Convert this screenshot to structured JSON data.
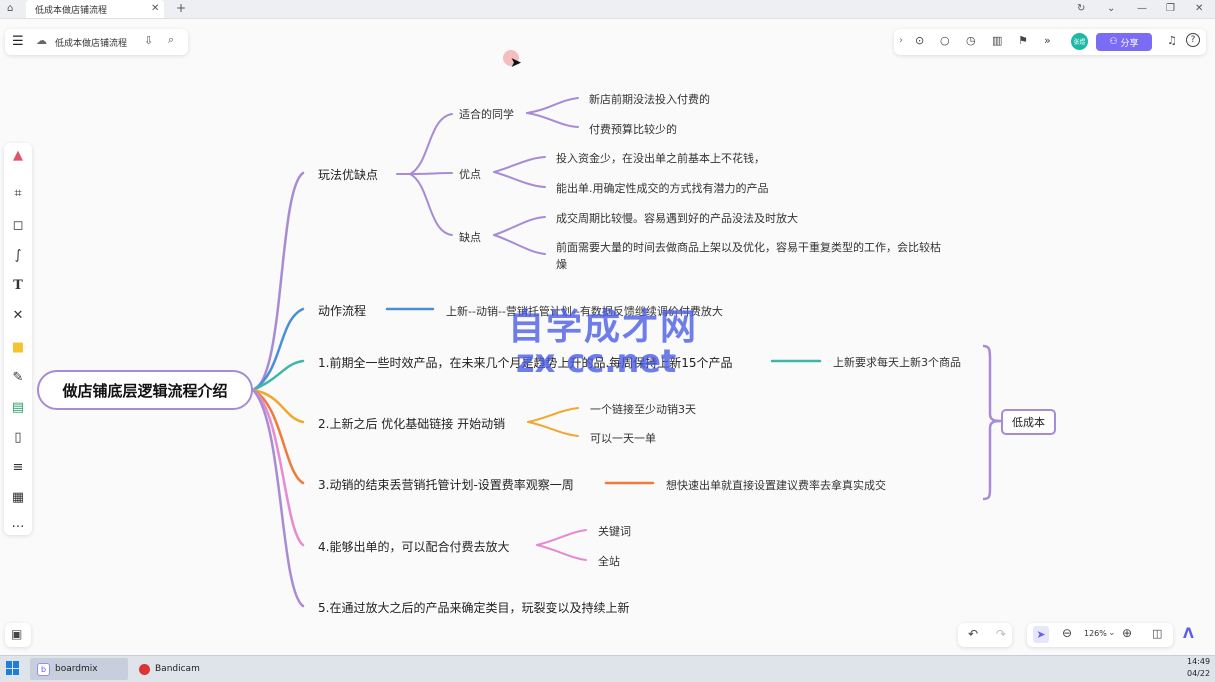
{
  "window": {
    "tab_title": "低成本做店铺流程"
  },
  "toolbar": {
    "doc_title": "低成本做店铺流程",
    "share_label": "分享",
    "avatar_text": "张煜"
  },
  "mindmap": {
    "root": "做店铺底层逻辑流程介绍",
    "b1": {
      "label": "玩法优缺点",
      "sub1": {
        "label": "适合的同学",
        "l1": "新店前期没法投入付费的",
        "l2": "付费预算比较少的"
      },
      "sub2": {
        "label": "优点",
        "l1": "投入资金少，在没出单之前基本上不花钱，",
        "l2": "能出单.用确定性成交的方式找有潜力的产品"
      },
      "sub3": {
        "label": "缺点",
        "l1": "成交周期比较慢。容易遇到好的产品没法及时放大",
        "l2a": "前面需要大量的时间去做商品上架以及优化，容易干重复类型的工作，会比较枯",
        "l2b": "燥"
      }
    },
    "b2": {
      "label": "动作流程",
      "l1": "上新--动销--营销托管计划--有数据反馈继续调价付费放大"
    },
    "b3": {
      "label": "1.前期全一些时效产品，在未来几个月是趋势上升的品.每周保持上新15个产品",
      "l1": "上新要求每天上新3个商品"
    },
    "b4": {
      "label": "2.上新之后 优化基础链接 开始动销",
      "l1": "一个链接至少动销3天",
      "l2": "可以一天一单"
    },
    "b5": {
      "label": "3.动销的结束丢营销托管计划-设置费率观察一周",
      "l1": "想快速出单就直接设置建议费率去拿真实成交"
    },
    "b6": {
      "label": "4.能够出单的，可以配合付费去放大",
      "l1": "关键词",
      "l2": "全站"
    },
    "b7": {
      "label": "5.在通过放大之后的产品来确定类目，玩裂变以及持续上新"
    },
    "group_label": "低成本"
  },
  "watermark": {
    "line1": "自学成才网",
    "line2": "zx cc.net"
  },
  "zoom": {
    "level": "126%"
  },
  "taskbar": {
    "app1": "boardmix",
    "app2": "Bandicam",
    "time": "14:49",
    "date": "04/22"
  },
  "colors": {
    "purple": "#a78bd4",
    "blue": "#4a8fd6",
    "teal": "#3fb7a8",
    "orange": "#f0a830",
    "deep_orange": "#ee7b3a",
    "pink": "#e58bcf",
    "accent": "#7b6cf6"
  }
}
